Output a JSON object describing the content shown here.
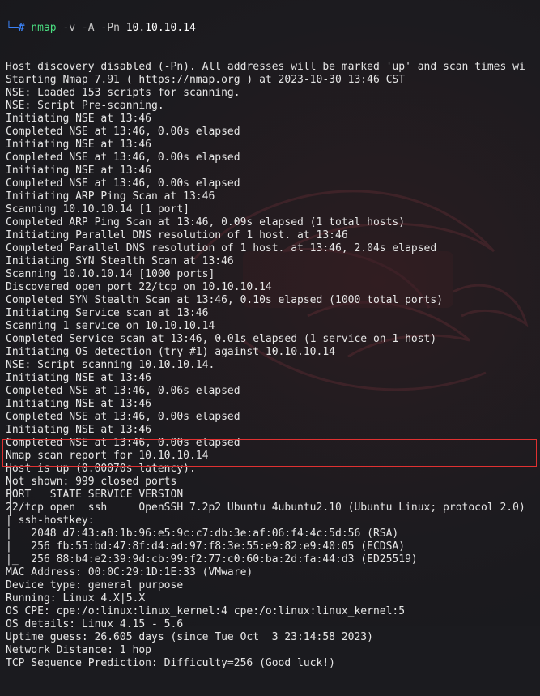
{
  "prompt": {
    "glyph": "└─",
    "hash": "#",
    "command": "nmap",
    "args": " -v -A -Pn ",
    "target": "10.10.10.14"
  },
  "output_lines": [
    "Host discovery disabled (-Pn). All addresses will be marked 'up' and scan times wi",
    "Starting Nmap 7.91 ( https://nmap.org ) at 2023-10-30 13:46 CST",
    "NSE: Loaded 153 scripts for scanning.",
    "NSE: Script Pre-scanning.",
    "Initiating NSE at 13:46",
    "Completed NSE at 13:46, 0.00s elapsed",
    "Initiating NSE at 13:46",
    "Completed NSE at 13:46, 0.00s elapsed",
    "Initiating NSE at 13:46",
    "Completed NSE at 13:46, 0.00s elapsed",
    "Initiating ARP Ping Scan at 13:46",
    "Scanning 10.10.10.14 [1 port]",
    "Completed ARP Ping Scan at 13:46, 0.09s elapsed (1 total hosts)",
    "Initiating Parallel DNS resolution of 1 host. at 13:46",
    "Completed Parallel DNS resolution of 1 host. at 13:46, 2.04s elapsed",
    "Initiating SYN Stealth Scan at 13:46",
    "Scanning 10.10.10.14 [1000 ports]",
    "Discovered open port 22/tcp on 10.10.10.14",
    "Completed SYN Stealth Scan at 13:46, 0.10s elapsed (1000 total ports)",
    "Initiating Service scan at 13:46",
    "Scanning 1 service on 10.10.10.14",
    "Completed Service scan at 13:46, 0.01s elapsed (1 service on 1 host)",
    "Initiating OS detection (try #1) against 10.10.10.14",
    "NSE: Script scanning 10.10.10.14.",
    "Initiating NSE at 13:46",
    "Completed NSE at 13:46, 0.06s elapsed",
    "Initiating NSE at 13:46",
    "Completed NSE at 13:46, 0.00s elapsed",
    "Initiating NSE at 13:46",
    "Completed NSE at 13:46, 0.00s elapsed",
    "Nmap scan report for 10.10.10.14",
    "Host is up (0.00070s latency).",
    "Not shown: 999 closed ports",
    "PORT   STATE SERVICE VERSION",
    "22/tcp open  ssh     OpenSSH 7.2p2 Ubuntu 4ubuntu2.10 (Ubuntu Linux; protocol 2.0)",
    "| ssh-hostkey:",
    "|   2048 d7:43:a8:1b:96:e5:9c:c7:db:3e:af:06:f4:4c:5d:56 (RSA)",
    "|   256 fb:55:bd:47:8f:d4:ad:97:f8:3e:55:e9:82:e9:40:05 (ECDSA)",
    "|_  256 88:b4:e2:39:9d:cb:99:f2:77:c0:60:ba:2d:fa:44:d3 (ED25519)",
    "MAC Address: 00:0C:29:1D:1E:33 (VMware)",
    "Device type: general purpose",
    "Running: Linux 4.X|5.X",
    "OS CPE: cpe:/o:linux:linux_kernel:4 cpe:/o:linux:linux_kernel:5",
    "OS details: Linux 4.15 - 5.6",
    "Uptime guess: 26.605 days (since Tue Oct  3 23:14:58 2023)",
    "Network Distance: 1 hop",
    "TCP Sequence Prediction: Difficulty=256 (Good luck!)"
  ],
  "highlight": {
    "color": "#e03131"
  },
  "colors": {
    "background": "#1b1b1f",
    "text": "#e6e6e6",
    "prompt": "#3b82f6",
    "command": "#4ade80"
  },
  "icons": {
    "wallpaper": "kali-dragon-watermark"
  }
}
